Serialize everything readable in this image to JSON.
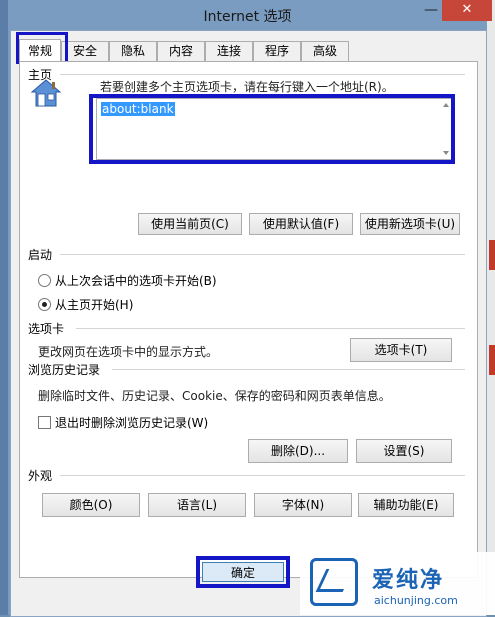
{
  "window": {
    "title": "Internet 选项",
    "close_label": "✕",
    "minimize_label": "—"
  },
  "tabs": [
    {
      "label": "常规",
      "active": true
    },
    {
      "label": "安全"
    },
    {
      "label": "隐私"
    },
    {
      "label": "内容"
    },
    {
      "label": "连接"
    },
    {
      "label": "程序"
    },
    {
      "label": "高级"
    }
  ],
  "homepage": {
    "group_title": "主页",
    "hint": "若要创建多个主页选项卡，请在每行键入一个地址(R)。",
    "value": "about:blank",
    "buttons": [
      "使用当前页(C)",
      "使用默认值(F)",
      "使用新选项卡(U)"
    ]
  },
  "startup": {
    "group_title": "启动",
    "options": [
      {
        "label": "从上次会话中的选项卡开始(B)",
        "selected": false
      },
      {
        "label": "从主页开始(H)",
        "selected": true
      }
    ]
  },
  "tabs_group": {
    "group_title": "选项卡",
    "desc": "更改网页在选项卡中的显示方式。",
    "button": "选项卡(T)"
  },
  "history": {
    "group_title": "浏览历史记录",
    "desc": "删除临时文件、历史记录、Cookie、保存的密码和网页表单信息。",
    "checkbox_label": "退出时删除浏览历史记录(W)",
    "delete_button": "删除(D)...",
    "settings_button": "设置(S)"
  },
  "appearance": {
    "group_title": "外观",
    "buttons": [
      "颜色(O)",
      "语言(L)",
      "字体(N)",
      "辅助功能(E)"
    ]
  },
  "footer": {
    "ok_label": "确定"
  },
  "watermark": {
    "text": "爱纯净",
    "url": "aichunjing.com"
  },
  "colors": {
    "highlight": "#1515c8",
    "selection": "#3399ff",
    "close": "#c7463a"
  }
}
